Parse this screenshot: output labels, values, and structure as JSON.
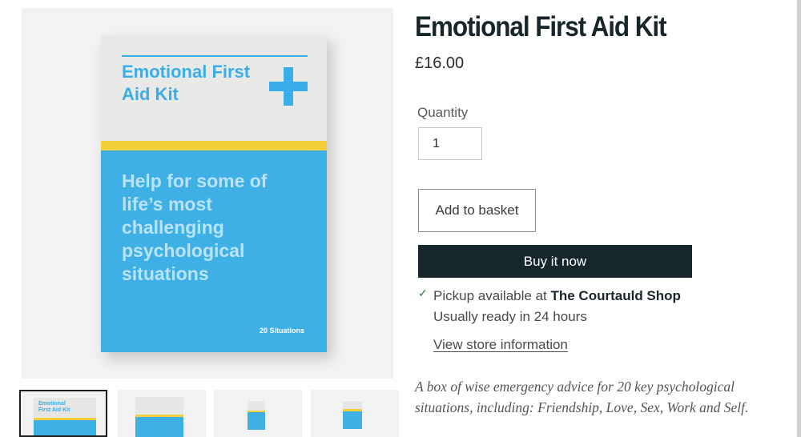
{
  "gallery": {
    "main_image": {
      "lid_title": "Emotional First Aid Kit",
      "tagline": "Help for some of life’s most challenging psychological situations",
      "situations": "20 Situations",
      "plus_icon": "medical-cross-icon",
      "colors": {
        "lid": "#e9e9e7",
        "band": "#f2cf3b",
        "body": "#3fb0e6",
        "accent": "#3aaee8"
      }
    },
    "thumbnails": [
      {
        "view": "front",
        "selected": true,
        "caption": "Emotional First Aid Kit"
      },
      {
        "view": "front-angled",
        "selected": false
      },
      {
        "view": "side",
        "selected": false
      },
      {
        "view": "side-open",
        "selected": false
      }
    ]
  },
  "product": {
    "title": "Emotional First Aid Kit",
    "price": "£16.00",
    "quantity_label": "Quantity",
    "quantity_value": "1",
    "add_to_basket_label": "Add to basket",
    "buy_now_label": "Buy it now",
    "pickup": {
      "check_icon": "check-icon",
      "prefix": "Pickup available at ",
      "store_name": "The Courtauld Shop",
      "ready_text": "Usually ready in 24 hours",
      "store_link_label": "View store information"
    },
    "description": "A box of wise emergency advice for 20 key psychological situations, including: Friendship, Love, Sex, Work and Self."
  },
  "colors": {
    "dark_button": "#17262b",
    "button_text": "#ffffff",
    "check": "#2e7d32"
  }
}
